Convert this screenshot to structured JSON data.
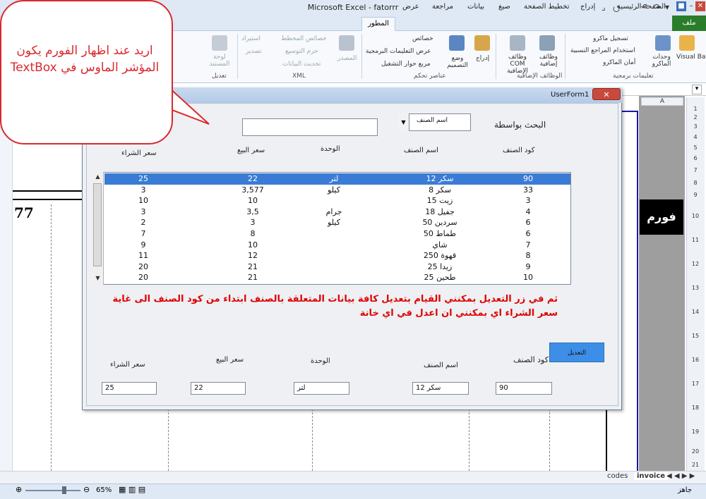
{
  "window": {
    "title": "Microsoft Excel - fatorrr",
    "quick_access": [
      "⌟",
      "⭯",
      "↶",
      "↷",
      "▾"
    ],
    "controls": {
      "help": "?",
      "min": "–",
      "restore": "□",
      "close": "✕"
    }
  },
  "ribbon": {
    "tabs": [
      "ملف",
      "الصفحة الرئيسية",
      "إدراج",
      "تخطيط الصفحة",
      "صيغ",
      "بيانات",
      "مراجعة",
      "عرض",
      "المطور"
    ],
    "groups": {
      "code": {
        "label": "تعليمات برمجية",
        "items": [
          "Visual Basic",
          "وحدات الماكرو",
          "تسجيل ماكرو",
          "استخدام المراجع النسبية",
          "أمان الماكرو"
        ]
      },
      "addins": {
        "label": "الوظائف الإضافية",
        "items": [
          "وظائف إضافية",
          "وظائف COM الإضافية"
        ]
      },
      "controls": {
        "label": "عناصر تحكم",
        "items": [
          "إدراج",
          "وضع التصميم",
          "خصائص",
          "عرض التعليمات البرمجية",
          "مربع حوار التشغيل"
        ]
      },
      "xml": {
        "label": "XML",
        "items": [
          "المصدر",
          "خصائص المخطط",
          "حزم التوسيع",
          "تحديث البيانات",
          "استيراد",
          "تصدير"
        ]
      },
      "modify": {
        "label": "تعديل",
        "items": [
          "لوحة المستند"
        ]
      }
    }
  },
  "sheet": {
    "column_a": "A",
    "row_numbers": [
      "1",
      "2",
      "3",
      "4",
      "5",
      "6",
      "7",
      "8",
      "9",
      "10",
      "11",
      "12",
      "13",
      "14",
      "15",
      "16",
      "17",
      "18",
      "19",
      "20",
      "21"
    ],
    "cell_value": "77",
    "form_button": "فورم",
    "tabs": [
      "codes",
      "invoice"
    ]
  },
  "status": {
    "ready": "جاهز",
    "zoom": "65%"
  },
  "callout": {
    "text": "اريد عند اظهار الفورم يكون المؤشر الماوس في TextBox"
  },
  "userform": {
    "title": "UserForm1",
    "close": "✕",
    "search_label": "البحث بواسطة",
    "combo_value": "اسم الصنف",
    "search_value": "",
    "headers": [
      "كود الصنف",
      "اسم الصنف",
      "الوحدة",
      "سعر البيع",
      "سعر الشراء"
    ],
    "list": [
      {
        "code": "90",
        "name": "سكر 12",
        "unit": "لتر",
        "sell": "22",
        "buy": "25"
      },
      {
        "code": "33",
        "name": "سكر 8",
        "unit": "كيلو",
        "sell": "3,577",
        "buy": "3"
      },
      {
        "code": "3",
        "name": "زيت 15",
        "unit": "",
        "sell": "10",
        "buy": "10"
      },
      {
        "code": "4",
        "name": "جفيل 18",
        "unit": "جرام",
        "sell": "3,5",
        "buy": "3"
      },
      {
        "code": "6",
        "name": "سردين 50",
        "unit": "كيلو",
        "sell": "3",
        "buy": "2"
      },
      {
        "code": "6",
        "name": "طماط 50",
        "unit": "",
        "sell": "8",
        "buy": "7"
      },
      {
        "code": "7",
        "name": "شاي",
        "unit": "",
        "sell": "10",
        "buy": "9"
      },
      {
        "code": "8",
        "name": "قهوة 250",
        "unit": "",
        "sell": "12",
        "buy": "11"
      },
      {
        "code": "9",
        "name": "زيدا 25",
        "unit": "",
        "sell": "21",
        "buy": "20"
      },
      {
        "code": "10",
        "name": "طحين 25",
        "unit": "",
        "sell": "21",
        "buy": "20"
      }
    ],
    "selected_index": 0,
    "note": "ثم في زر التعديل بمكنني القيام   بتعديل كافة بيانات المتعلقة بالصنف ابتداء من كود الصنف الى غاية سعر الشراء اي بمكنني ان اعدل في اي خانة",
    "edit_button": "التعديل",
    "fields": {
      "code": {
        "label": "كود الصنف",
        "value": "90"
      },
      "name": {
        "label": "اسم الصنف",
        "value": "سكر 12"
      },
      "unit": {
        "label": "الوحدة",
        "value": "لتر"
      },
      "sell": {
        "label": "سعر البيع",
        "value": "22"
      },
      "buy": {
        "label": "سعر الشراء",
        "value": "25"
      }
    }
  }
}
